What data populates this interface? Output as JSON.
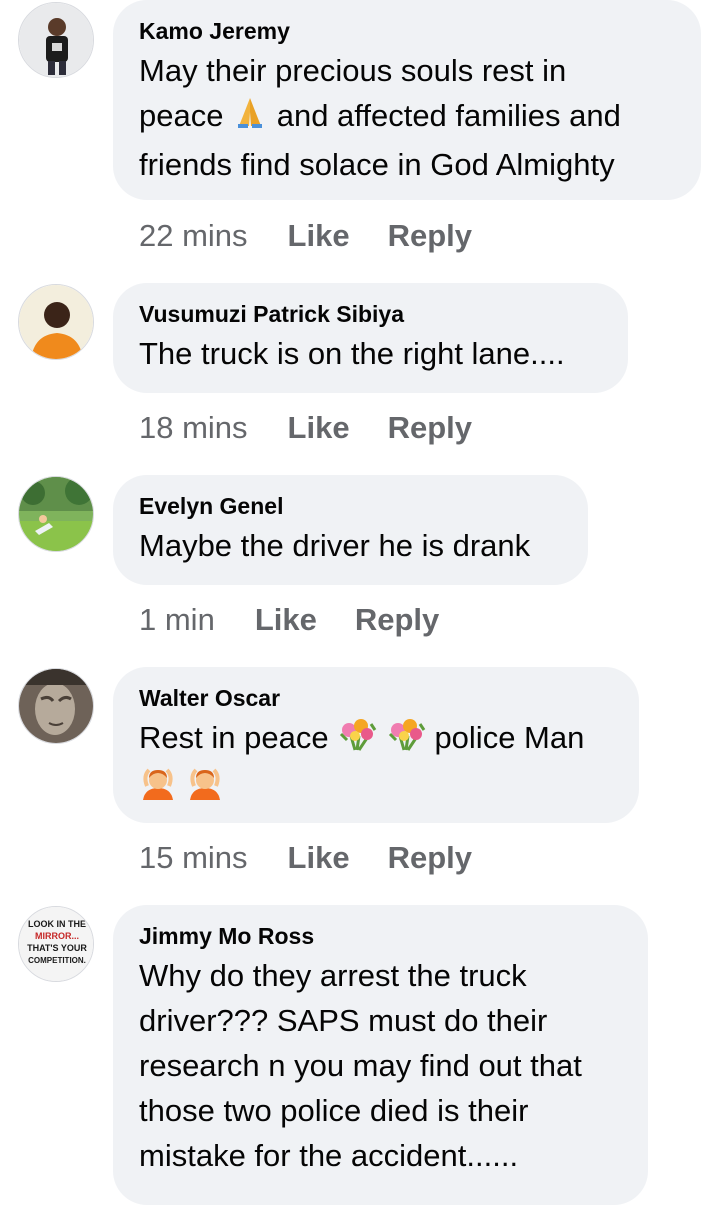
{
  "comments": [
    {
      "author": "Kamo Jeremy",
      "lines": [
        "May their precious souls rest in",
        "peace",
        "and affected families and",
        "friends find solace in God Almighty"
      ],
      "time": "22 mins",
      "like_label": "Like",
      "reply_label": "Reply",
      "avatar_icon": "man-in-black-tshirt-photo",
      "emoji": [
        "folded-hands-emoji"
      ]
    },
    {
      "author": "Vusumuzi Patrick Sibiya",
      "lines": [
        "The truck is on the right lane...."
      ],
      "time": "18 mins",
      "like_label": "Like",
      "reply_label": "Reply",
      "avatar_icon": "man-in-orange-shirt-photo"
    },
    {
      "author": "Evelyn Genel",
      "lines": [
        "Maybe the driver he is drank"
      ],
      "time": "1 min",
      "like_label": "Like",
      "reply_label": "Reply",
      "avatar_icon": "person-on-grass-photo"
    },
    {
      "author": "Walter Oscar",
      "lines": [
        "Rest in peace",
        "police Man"
      ],
      "time": "15 mins",
      "like_label": "Like",
      "reply_label": "Reply",
      "avatar_icon": "stone-statue-face-photo",
      "emoji": [
        "bouquet-emoji",
        "bouquet-emoji",
        "person-gesturing-ok-emoji",
        "person-gesturing-ok-emoji"
      ]
    },
    {
      "author": "Jimmy Mo Ross",
      "lines": [
        "Why do they arrest the truck",
        "driver??? SAPS must do their",
        "research n you may find out that",
        "those two police died is their",
        "mistake for the accident......"
      ],
      "avatar_icon": "mirror-quote-badge",
      "avatar_text": [
        "LOOK IN THE",
        "MIRROR...",
        "THAT'S YOUR",
        "COMPETITION."
      ]
    }
  ],
  "colors": {
    "bubble": "#f0f2f5",
    "text": "#050505",
    "meta": "#65676b"
  }
}
